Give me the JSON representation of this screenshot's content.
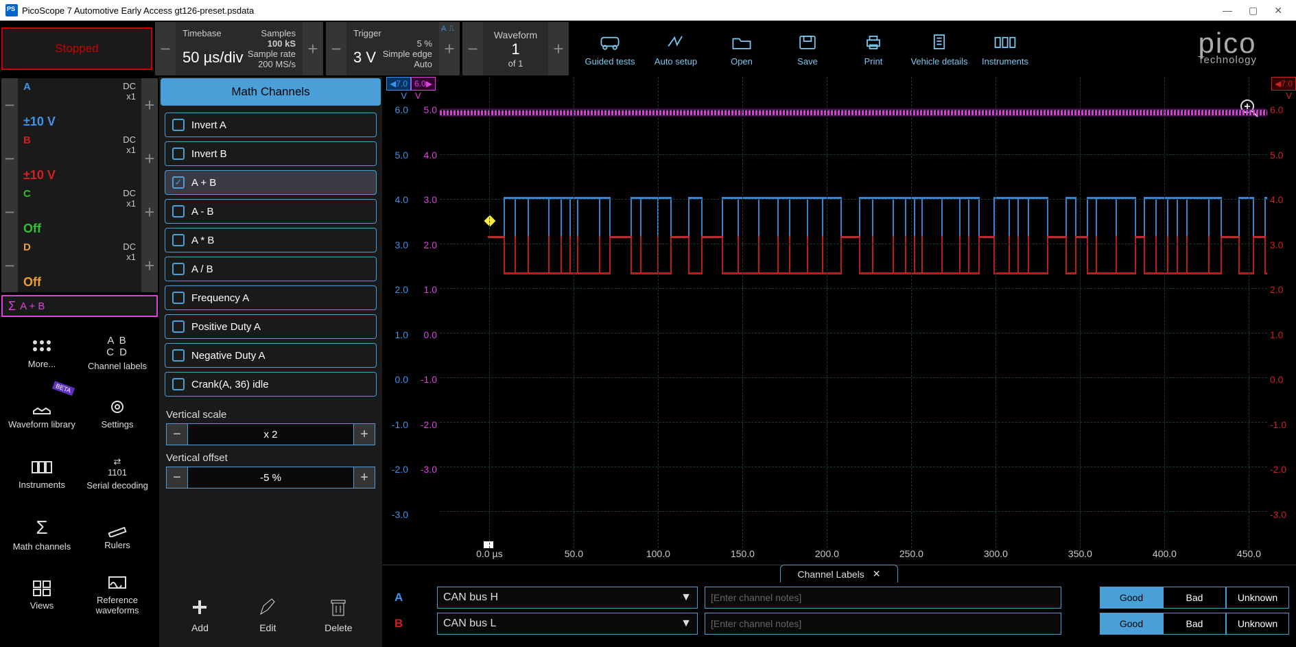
{
  "window": {
    "title": "PicoScope 7 Automotive Early Access gt126-preset.psdata"
  },
  "status": {
    "label": "Stopped"
  },
  "timebase": {
    "title": "Timebase",
    "value": "50 µs/div",
    "samples_label": "Samples",
    "samples": "100 kS",
    "rate_label": "Sample rate",
    "rate": "200 MS/s"
  },
  "trigger": {
    "title": "Trigger",
    "value": "3 V",
    "channel": "A",
    "pct": "5 %",
    "edge": "Simple edge",
    "mode": "Auto"
  },
  "waveform": {
    "title": "Waveform",
    "current": "1",
    "of": "of 1"
  },
  "tools": {
    "guided": "Guided tests",
    "auto": "Auto setup",
    "open": "Open",
    "save": "Save",
    "print": "Print",
    "vehicle": "Vehicle details",
    "instr": "Instruments"
  },
  "logo": {
    "brand": "pico",
    "tech": "Technology"
  },
  "channels": [
    {
      "id": "A",
      "coupling": "DC",
      "mult": "x1",
      "range": "±10 V"
    },
    {
      "id": "B",
      "coupling": "DC",
      "mult": "x1",
      "range": "±10 V"
    },
    {
      "id": "C",
      "coupling": "DC",
      "mult": "x1",
      "range": "Off"
    },
    {
      "id": "D",
      "coupling": "DC",
      "mult": "x1",
      "range": "Off"
    }
  ],
  "math_channel_row": "A + B",
  "sidebar_tools": {
    "more": "More...",
    "chlabels": "Channel labels",
    "wavelib": "Waveform library",
    "settings": "Settings",
    "instruments": "Instruments",
    "serial": "Serial decoding",
    "math": "Math channels",
    "rulers": "Rulers",
    "views": "Views",
    "ref": "Reference waveforms",
    "beta": "BETA"
  },
  "mathpanel": {
    "title": "Math Channels",
    "items": [
      "Invert A",
      "Invert B",
      "A + B",
      "A - B",
      "A * B",
      "A / B",
      "Frequency A",
      "Positive Duty A",
      "Negative Duty A",
      "Crank(A, 36) idle"
    ],
    "selected": 2,
    "vscale_label": "Vertical scale",
    "vscale": "x 2",
    "voffset_label": "Vertical offset",
    "voffset": "-5 %",
    "add": "Add",
    "edit": "Edit",
    "delete": "Delete"
  },
  "axes": {
    "left_top": "7.0",
    "left_unit": "V",
    "left2_top": "6.0",
    "left2_unit": "V",
    "right_top": "7.0",
    "right_unit": "V",
    "y_left": [
      "6.0",
      "5.0",
      "4.0",
      "3.0",
      "2.0",
      "1.0",
      "0.0",
      "-1.0",
      "-2.0",
      "-3.0"
    ],
    "y_left2": [
      "5.0",
      "4.0",
      "3.0",
      "2.0",
      "1.0",
      "0.0",
      "-1.0",
      "-2.0",
      "-3.0",
      ""
    ],
    "y_right": [
      "6.0",
      "5.0",
      "4.0",
      "3.0",
      "2.0",
      "1.0",
      "0.0",
      "-1.0",
      "-2.0",
      "-3.0"
    ],
    "x": [
      "0.0 µs",
      "50.0",
      "100.0",
      "150.0",
      "200.0",
      "250.0",
      "300.0",
      "350.0",
      "400.0",
      "450.0"
    ]
  },
  "chlabels_panel": {
    "title": "Channel Labels",
    "rows": [
      {
        "ch": "A",
        "name": "CAN bus H"
      },
      {
        "ch": "B",
        "name": "CAN bus L"
      }
    ],
    "notes_placeholder": "[Enter channel notes]",
    "buttons": [
      "Good",
      "Bad",
      "Unknown"
    ]
  }
}
